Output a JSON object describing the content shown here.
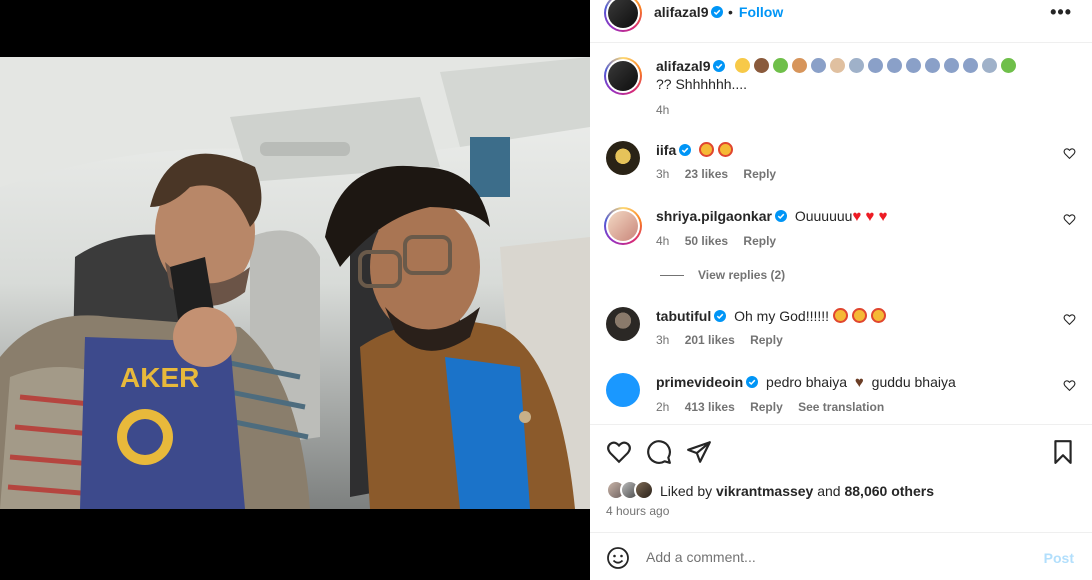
{
  "header": {
    "username": "alifazal9",
    "follow_label": "Follow",
    "bullet": "•",
    "more_label": "•••"
  },
  "caption": {
    "username": "alifazal9",
    "text_tail": "?? Shhhhhh....",
    "time": "4h"
  },
  "comments": [
    {
      "username": "iifa",
      "text": "",
      "time": "3h",
      "likes": "23 likes",
      "reply": "Reply"
    },
    {
      "username": "shriya.pilgaonkar",
      "text": "Ouuuuuu",
      "time": "4h",
      "likes": "50 likes",
      "reply": "Reply"
    },
    {
      "username": "tabutiful",
      "text": "Oh my God!!!!!!",
      "time": "3h",
      "likes": "201 likes",
      "reply": "Reply"
    },
    {
      "username": "primevideoin",
      "text_a": "pedro bhaiya",
      "text_b": "guddu bhaiya",
      "time": "2h",
      "likes": "413 likes",
      "reply": "Reply",
      "translate": "See translation"
    }
  ],
  "view_replies": "View replies (2)",
  "likes": {
    "prefix": "Liked by",
    "user": "vikrantmassey",
    "mid": "and",
    "count": "88,060 others"
  },
  "posted_ago": "4 hours ago",
  "comment_box": {
    "placeholder": "Add a comment...",
    "post_label": "Post"
  },
  "colors": {
    "accent": "#0095f6",
    "post_disabled": "#b2dffc",
    "verified": "#0095f6",
    "heart_red": "#ed1c24"
  }
}
